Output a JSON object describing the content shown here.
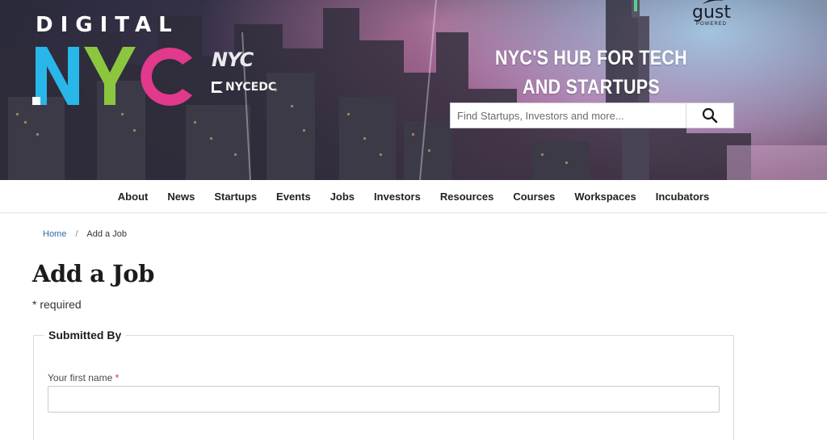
{
  "brand": {
    "logo_top": "DIGITAL",
    "logo_main": "NYC",
    "partner_nyc": "NYC",
    "partner_edc": "NYCEDC",
    "gust_word": "gust",
    "gust_powered": "POWERED"
  },
  "hero": {
    "tagline": "NYC'S HUB FOR TECH AND STARTUPS"
  },
  "search": {
    "placeholder": "Find Startups, Investors and more...",
    "value": ""
  },
  "nav": {
    "items": [
      "About",
      "News",
      "Startups",
      "Events",
      "Jobs",
      "Investors",
      "Resources",
      "Courses",
      "Workspaces",
      "Incubators"
    ]
  },
  "breadcrumb": {
    "home": "Home",
    "separator": "/",
    "current": "Add a Job"
  },
  "page": {
    "title": "Add a Job",
    "required_note": "* required"
  },
  "form": {
    "section_title": "Submitted By",
    "first_name_label": "Your first name",
    "required_marker": "*",
    "first_name_value": ""
  },
  "colors": {
    "logo_n": "#29b6e8",
    "logo_y": "#8cc63f",
    "logo_c": "#e2398c",
    "link": "#2a6ea6",
    "required": "#d2302b"
  }
}
